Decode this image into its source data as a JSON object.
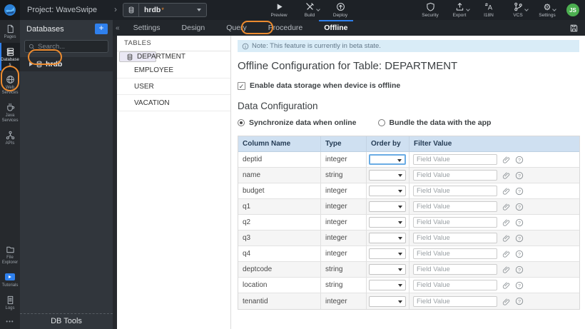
{
  "colors": {
    "annotation_orange": "#ed8b2f",
    "primary_blue": "#2f80ed",
    "note_bg": "#d9ecf7",
    "table_header_bg": "#cfe0f1",
    "selected_table_bg": "#eae8f4",
    "avatar_green": "#4caf50",
    "focus_border_blue": "#6aace4"
  },
  "glyphs": {
    "check": "✓",
    "breadcrumb": "›",
    "collapse": "«",
    "more": "•••",
    "gear": "⚙"
  },
  "topbar": {
    "project_label": "Project: WaveSwipe",
    "db_selector": {
      "value": "hrdb",
      "dirty_marker": "*"
    },
    "left_actions": [
      {
        "id": "preview",
        "label": "Preview",
        "icon": "play",
        "chevron": false
      },
      {
        "id": "build",
        "label": "Build",
        "icon": "build",
        "chevron": true
      },
      {
        "id": "deploy",
        "label": "Deploy",
        "icon": "deploy",
        "chevron": false
      }
    ],
    "right_actions": [
      {
        "id": "security",
        "label": "Security",
        "icon": "shield",
        "chevron": false
      },
      {
        "id": "export",
        "label": "Export",
        "icon": "export",
        "chevron": true
      },
      {
        "id": "i18n",
        "label": "I18N",
        "icon": "i18n",
        "chevron": false
      },
      {
        "id": "vcs",
        "label": "VCS",
        "icon": "vcs",
        "chevron": true
      },
      {
        "id": "settings",
        "label": "Settings",
        "icon": "gear",
        "chevron": true
      }
    ],
    "avatar_initials": "JS"
  },
  "sidebar": {
    "top_items": [
      {
        "id": "pages",
        "label": "Pages",
        "icon": "page",
        "active": false
      },
      {
        "id": "databases",
        "label": "Databases",
        "icon": "database",
        "active": true
      },
      {
        "id": "web-services",
        "label": "Web Services",
        "icon": "globe",
        "active": false
      },
      {
        "id": "java-services",
        "label": "Java Services",
        "icon": "coffee",
        "active": false
      },
      {
        "id": "apis",
        "label": "APIs",
        "icon": "apis",
        "active": false
      }
    ],
    "bottom_items": [
      {
        "id": "file-explorer",
        "label": "File Explorer",
        "icon": "folder"
      },
      {
        "id": "tutorials",
        "label": "Tutorials",
        "icon": "tutorial"
      },
      {
        "id": "logs",
        "label": "Logs",
        "icon": "logs"
      }
    ],
    "more_label": "•••"
  },
  "db_panel": {
    "title": "Databases",
    "add_button": "+",
    "search_placeholder": "Search...",
    "tree_item": {
      "label": "hrdb"
    },
    "footer": "DB Tools"
  },
  "tabs": {
    "items": [
      "Settings",
      "Design",
      "Query",
      "Procedure",
      "Offline"
    ],
    "active": "Offline"
  },
  "tables_panel": {
    "header": "TABLES",
    "items": [
      "DEPARTMENT",
      "EMPLOYEE",
      "USER",
      "VACATION"
    ],
    "selected": "DEPARTMENT"
  },
  "main": {
    "note": "Note: This feature is currently in beta state.",
    "title": "Offline Configuration for Table: DEPARTMENT",
    "enable_label": "Enable data storage when device is offline",
    "enable_checked": true,
    "section_title": "Data Configuration",
    "sync_options": [
      {
        "label": "Synchronize data when online",
        "selected": true
      },
      {
        "label": "Bundle the data with the app",
        "selected": false
      }
    ],
    "config_table": {
      "headers": [
        "Column Name",
        "Type",
        "Order by",
        "Filter Value"
      ],
      "filter_placeholder": "Field Value",
      "focused_row": "deptid",
      "rows": [
        {
          "name": "deptid",
          "type": "integer"
        },
        {
          "name": "name",
          "type": "string"
        },
        {
          "name": "budget",
          "type": "integer"
        },
        {
          "name": "q1",
          "type": "integer"
        },
        {
          "name": "q2",
          "type": "integer"
        },
        {
          "name": "q3",
          "type": "integer"
        },
        {
          "name": "q4",
          "type": "integer"
        },
        {
          "name": "deptcode",
          "type": "string"
        },
        {
          "name": "location",
          "type": "string"
        },
        {
          "name": "tenantid",
          "type": "integer"
        }
      ]
    }
  }
}
